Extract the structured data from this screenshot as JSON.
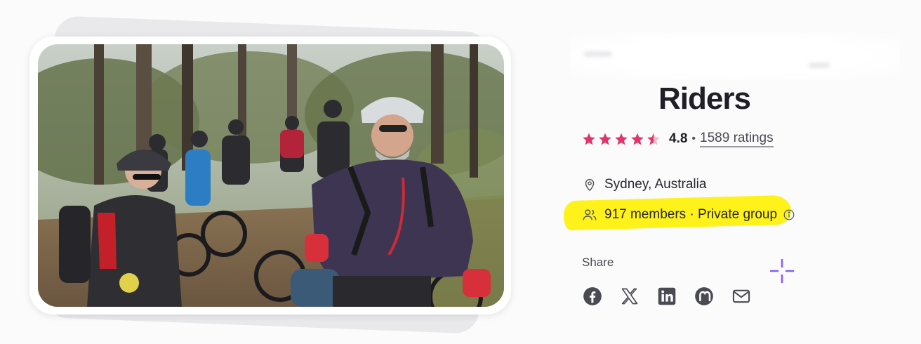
{
  "group": {
    "title": "Riders",
    "rating_value": "4.8",
    "rating_separator": "•",
    "rating_count": "1589 ratings",
    "stars_filled": 4.5,
    "location": "Sydney, Australia",
    "members_text": "917 members · Private group",
    "share_label": "Share"
  },
  "share": {
    "items": [
      "facebook-icon",
      "x-icon",
      "linkedin-icon",
      "nextdoor-icon",
      "email-icon"
    ]
  },
  "colors": {
    "star": "#e0356a",
    "highlight": "#fff21a",
    "text": "#1f1f25",
    "sparkle": "#8b5cf6"
  }
}
